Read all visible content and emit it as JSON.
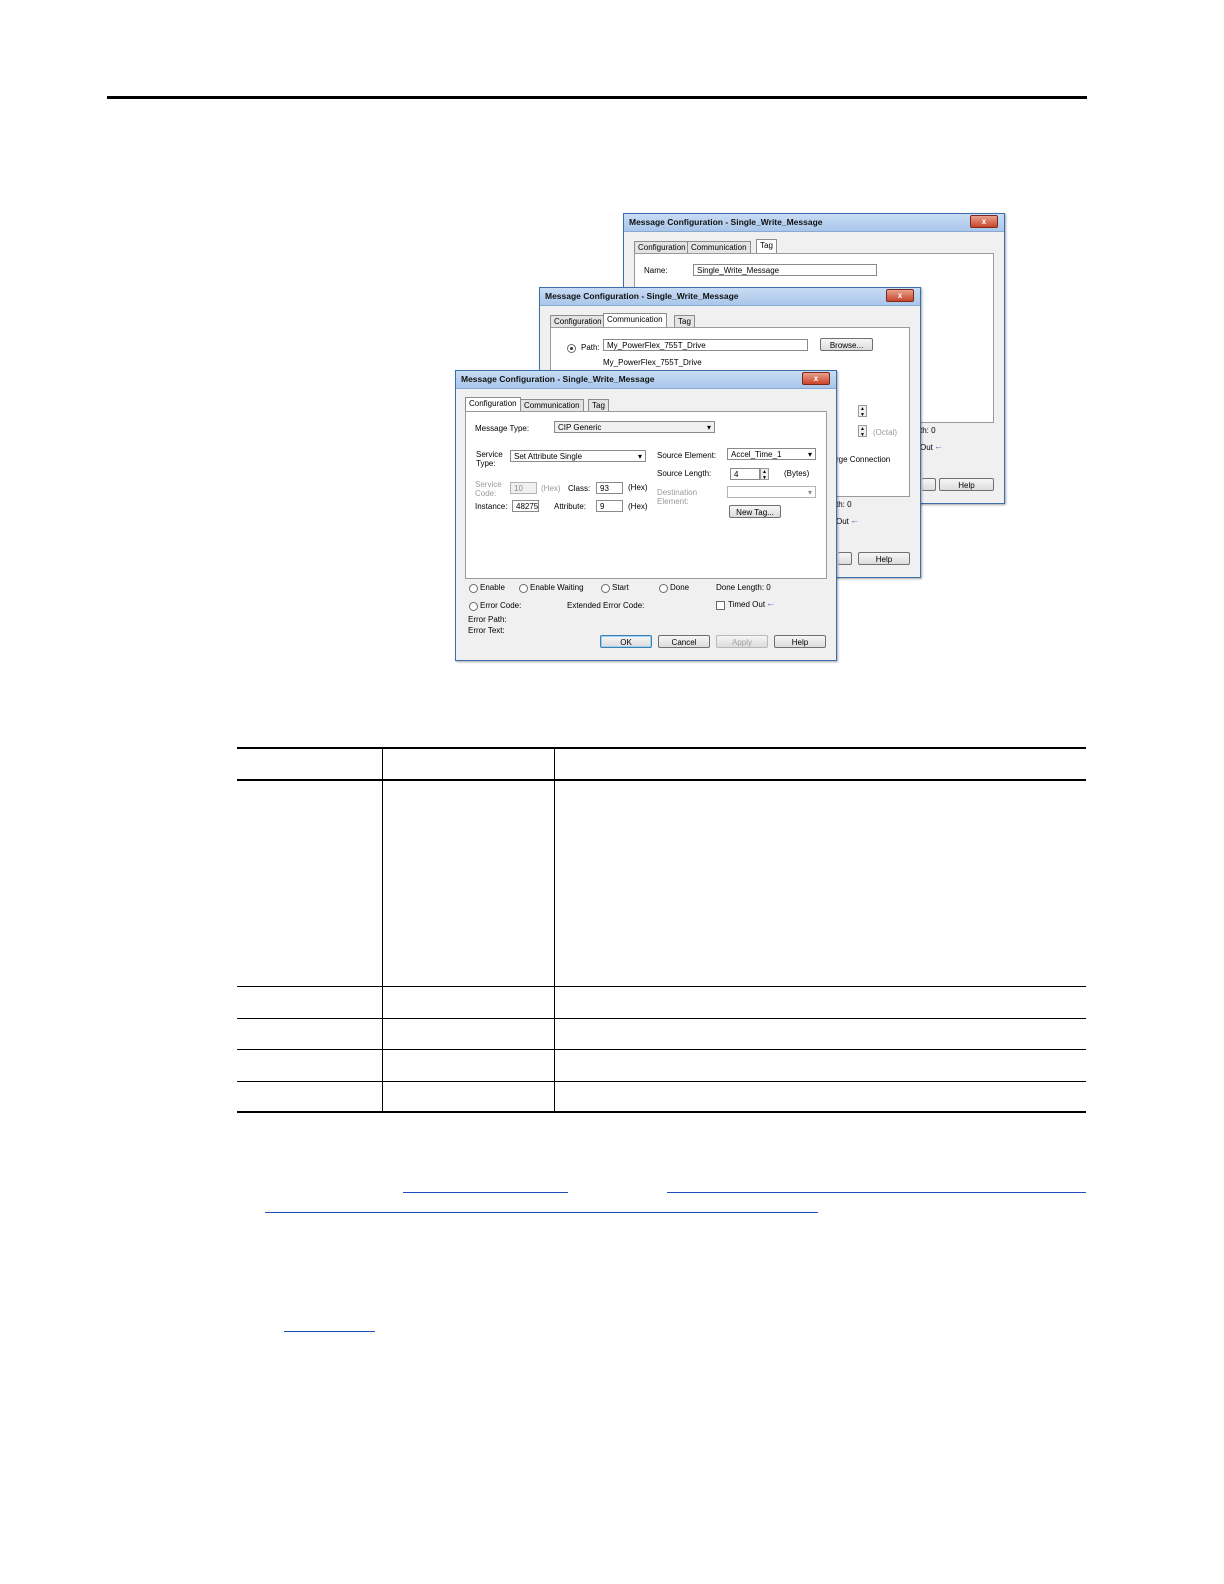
{
  "dialogs": {
    "back": {
      "title": "Message Configuration - Single_Write_Message",
      "close": "x",
      "tabs": [
        "Configuration",
        "Communication",
        "Tag"
      ],
      "name_label": "Name:",
      "name_value": "Single_Write_Message",
      "done_length_tail": "th:  0",
      "timed_out_tail": "Out",
      "help": "Help"
    },
    "middle": {
      "title": "Message Configuration - Single_Write_Message",
      "close": "x",
      "tabs": [
        "Configuration",
        "Communication",
        "Tag"
      ],
      "path_label": "Path:",
      "path_value": "My_PowerFlex_755T_Drive",
      "path_resolved": "My_PowerFlex_755T_Drive",
      "browse": "Browse...",
      "octal": "(Octal)",
      "large_connection_tail": "rge Connection",
      "done_length_tail": "th:  0",
      "timed_out_tail": "Out",
      "help": "Help"
    },
    "front": {
      "title": "Message Configuration - Single_Write_Message",
      "close": "x",
      "tabs": [
        "Configuration",
        "Communication",
        "Tag"
      ],
      "message_type_label": "Message Type:",
      "message_type_value": "CIP Generic",
      "service_type_label_1": "Service",
      "service_type_label_2": "Type:",
      "service_type_value": "Set Attribute Single",
      "service_code_label_1": "Service",
      "service_code_label_2": "Code:",
      "service_code_value": "10",
      "hex_label": "(Hex)",
      "class_label": "Class:",
      "class_value": "93",
      "instance_label": "Instance:",
      "instance_value": "48275",
      "attribute_label": "Attribute:",
      "attribute_value": "9",
      "source_element_label": "Source Element:",
      "source_element_value": "Accel_Time_1",
      "source_length_label": "Source Length:",
      "source_length_value": "4",
      "bytes_label": "(Bytes)",
      "destination_label_1": "Destination",
      "destination_label_2": "Element:",
      "new_tag": "New Tag...",
      "enable": "Enable",
      "enable_waiting": "Enable Waiting",
      "start": "Start",
      "done": "Done",
      "done_length": "Done Length:  0",
      "error_code": "Error Code:",
      "extended_error_code": "Extended Error Code:",
      "timed_out": "Timed Out",
      "error_path": "Error Path:",
      "error_text": "Error Text:",
      "ok": "OK",
      "cancel": "Cancel",
      "apply": "Apply",
      "help": "Help"
    }
  }
}
